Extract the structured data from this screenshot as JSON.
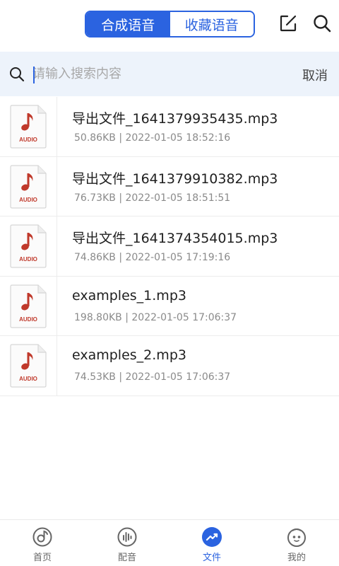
{
  "header": {
    "tabs": [
      {
        "label": "合成语音",
        "active": true
      },
      {
        "label": "收藏语音",
        "active": false
      }
    ],
    "edit_icon": "edit-icon",
    "search_icon": "search-icon"
  },
  "search": {
    "placeholder": "请输入搜索内容",
    "value": "",
    "cancel_label": "取消"
  },
  "files": [
    {
      "name": "导出文件_1641379935435.mp3",
      "meta": "50.86KB | 2022-01-05 18:52:16",
      "badge": "AUDIO"
    },
    {
      "name": "导出文件_1641379910382.mp3",
      "meta": "76.73KB | 2022-01-05 18:51:51",
      "badge": "AUDIO"
    },
    {
      "name": "导出文件_1641374354015.mp3",
      "meta": "74.86KB | 2022-01-05 17:19:16",
      "badge": "AUDIO"
    },
    {
      "name": "examples_1.mp3",
      "meta": "198.80KB | 2022-01-05 17:06:37",
      "badge": "AUDIO"
    },
    {
      "name": "examples_2.mp3",
      "meta": "74.53KB | 2022-01-05 17:06:37",
      "badge": "AUDIO"
    }
  ],
  "bottom_nav": [
    {
      "label": "首页",
      "icon": "disc-icon",
      "active": false
    },
    {
      "label": "配音",
      "icon": "audio-bars-icon",
      "active": false
    },
    {
      "label": "文件",
      "icon": "trend-icon",
      "active": true
    },
    {
      "label": "我的",
      "icon": "face-icon",
      "active": false
    }
  ],
  "colors": {
    "accent": "#2b63e0",
    "search_bg": "#edf3fb",
    "audio_red": "#c0392b"
  }
}
